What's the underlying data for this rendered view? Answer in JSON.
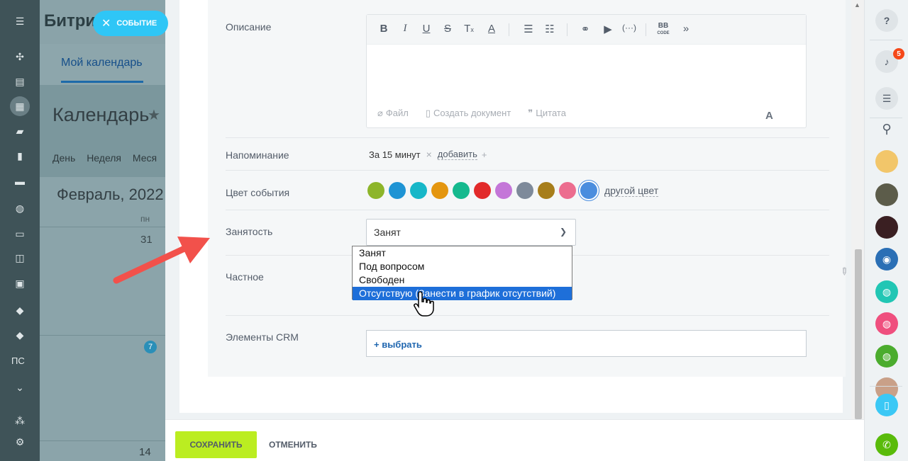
{
  "left_app": {
    "brand": "Битри",
    "event_chip": "СОБЫТИЕ",
    "tab_my_calendar": "Мой календарь",
    "page_title": "Календарь",
    "views": [
      "День",
      "Неделя",
      "Меся"
    ],
    "month": "Февраль, 2022",
    "dow": "пн",
    "day_31": "31",
    "badge_7": "7",
    "day_14": "14",
    "ps": "ПС"
  },
  "form": {
    "description_label": "Описание",
    "editor_bottom": {
      "file": "Файл",
      "create_doc": "Создать документ",
      "quote": "Цитата",
      "font_a": "A"
    },
    "reminder_label": "Напоминание",
    "reminder_value": "За 15 минут",
    "reminder_add": "добавить",
    "color_label": "Цвет события",
    "colors": [
      "#8db52a",
      "#1f94d4",
      "#17b7c8",
      "#e4960f",
      "#15b98e",
      "#e22a2a",
      "#c476d8",
      "#7e8a9a",
      "#a77e1b",
      "#ec6d8f",
      "#4a8dde"
    ],
    "other_color": "другой цвет",
    "busy_label": "Занятость",
    "busy_selected": "Занят",
    "busy_options": [
      "Занят",
      "Под вопросом",
      "Свободен",
      "Отсутствую (Занести в график отсутствий)"
    ],
    "private_label": "Частное",
    "crm_label": "Элементы CRM",
    "crm_choose": "+ выбрать"
  },
  "footer": {
    "save": "СОХРАНИТЬ",
    "cancel": "ОТМЕНИТЬ"
  },
  "right_sidebar": {
    "notif_count": "5"
  }
}
